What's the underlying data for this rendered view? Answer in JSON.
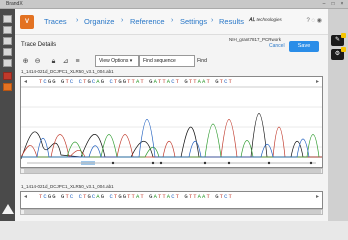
{
  "window": {
    "title": "BrandX"
  },
  "app": {
    "logo_label": "V"
  },
  "nav": {
    "tabs": [
      {
        "label": "Traces"
      },
      {
        "label": "Organize"
      },
      {
        "label": "Reference"
      },
      {
        "label": "Settings"
      },
      {
        "label": "Results"
      }
    ],
    "separator": "›"
  },
  "brand": {
    "label": "technologies"
  },
  "header": {
    "section_title": "Trace Details",
    "file_name": "NIH_grant7817_PCRwork",
    "cancel_label": "Cancel",
    "save_label": "Save"
  },
  "toolbar": {
    "view_options_label": "View Options ▾",
    "find_value": "Find sequence",
    "find_label": "Find"
  },
  "traces": [
    {
      "label": "1_1414-021d_DCJPC1_XLR50_v3.1_004.ab1",
      "sequence": [
        {
          "b": "T",
          "c": "#c0392b"
        },
        {
          "b": "C",
          "c": "#1f5fbf"
        },
        {
          "b": "G",
          "c": "#111"
        },
        {
          "b": "G",
          "c": "#111"
        },
        {
          "b": " ",
          "c": "#111"
        },
        {
          "b": "G",
          "c": "#111"
        },
        {
          "b": "T",
          "c": "#c0392b"
        },
        {
          "b": "C",
          "c": "#1f5fbf"
        },
        {
          "b": " ",
          "c": "#111"
        },
        {
          "b": "C",
          "c": "#1f5fbf"
        },
        {
          "b": "T",
          "c": "#c0392b"
        },
        {
          "b": "G",
          "c": "#111"
        },
        {
          "b": "C",
          "c": "#1f5fbf"
        },
        {
          "b": "A",
          "c": "#2e9b2e"
        },
        {
          "b": "G",
          "c": "#111"
        },
        {
          "b": " ",
          "c": "#111"
        },
        {
          "b": "C",
          "c": "#1f5fbf"
        },
        {
          "b": "T",
          "c": "#c0392b"
        },
        {
          "b": "G",
          "c": "#111"
        },
        {
          "b": "G",
          "c": "#111"
        },
        {
          "b": "T",
          "c": "#c0392b"
        },
        {
          "b": "T",
          "c": "#c0392b"
        },
        {
          "b": "A",
          "c": "#2e9b2e"
        },
        {
          "b": "T",
          "c": "#c0392b"
        },
        {
          "b": " ",
          "c": "#111"
        },
        {
          "b": "G",
          "c": "#111"
        },
        {
          "b": "A",
          "c": "#2e9b2e"
        },
        {
          "b": "T",
          "c": "#c0392b"
        },
        {
          "b": "T",
          "c": "#c0392b"
        },
        {
          "b": "A",
          "c": "#2e9b2e"
        },
        {
          "b": "C",
          "c": "#1f5fbf"
        },
        {
          "b": "T",
          "c": "#c0392b"
        },
        {
          "b": " ",
          "c": "#111"
        },
        {
          "b": "G",
          "c": "#111"
        },
        {
          "b": "T",
          "c": "#c0392b"
        },
        {
          "b": "T",
          "c": "#c0392b"
        },
        {
          "b": "A",
          "c": "#2e9b2e"
        },
        {
          "b": "A",
          "c": "#2e9b2e"
        },
        {
          "b": "T",
          "c": "#c0392b"
        },
        {
          "b": " ",
          "c": "#111"
        },
        {
          "b": "G",
          "c": "#111"
        },
        {
          "b": "T",
          "c": "#c0392b"
        },
        {
          "b": "C",
          "c": "#1f5fbf"
        },
        {
          "b": "T",
          "c": "#c0392b"
        }
      ]
    },
    {
      "label": "1_1414-021d_DCJPC1_XLR50_v3.1_004.ab1",
      "sequence": [
        {
          "b": "T",
          "c": "#c0392b"
        },
        {
          "b": "C",
          "c": "#1f5fbf"
        },
        {
          "b": "G",
          "c": "#111"
        },
        {
          "b": "G",
          "c": "#111"
        },
        {
          "b": " ",
          "c": "#111"
        },
        {
          "b": "G",
          "c": "#111"
        },
        {
          "b": "T",
          "c": "#c0392b"
        },
        {
          "b": "C",
          "c": "#1f5fbf"
        },
        {
          "b": " ",
          "c": "#111"
        },
        {
          "b": "C",
          "c": "#1f5fbf"
        },
        {
          "b": "T",
          "c": "#c0392b"
        },
        {
          "b": "G",
          "c": "#111"
        },
        {
          "b": "C",
          "c": "#1f5fbf"
        },
        {
          "b": "A",
          "c": "#2e9b2e"
        },
        {
          "b": "G",
          "c": "#111"
        },
        {
          "b": " ",
          "c": "#111"
        },
        {
          "b": "C",
          "c": "#1f5fbf"
        },
        {
          "b": "T",
          "c": "#c0392b"
        },
        {
          "b": "G",
          "c": "#111"
        },
        {
          "b": "G",
          "c": "#111"
        },
        {
          "b": "T",
          "c": "#c0392b"
        },
        {
          "b": "T",
          "c": "#c0392b"
        },
        {
          "b": "A",
          "c": "#2e9b2e"
        },
        {
          "b": "T",
          "c": "#c0392b"
        },
        {
          "b": " ",
          "c": "#111"
        },
        {
          "b": "G",
          "c": "#111"
        },
        {
          "b": "A",
          "c": "#2e9b2e"
        },
        {
          "b": "T",
          "c": "#c0392b"
        },
        {
          "b": "T",
          "c": "#c0392b"
        },
        {
          "b": "A",
          "c": "#2e9b2e"
        },
        {
          "b": "C",
          "c": "#1f5fbf"
        },
        {
          "b": "T",
          "c": "#c0392b"
        },
        {
          "b": " ",
          "c": "#111"
        },
        {
          "b": "G",
          "c": "#111"
        },
        {
          "b": "T",
          "c": "#c0392b"
        },
        {
          "b": "T",
          "c": "#c0392b"
        },
        {
          "b": "A",
          "c": "#2e9b2e"
        },
        {
          "b": "A",
          "c": "#2e9b2e"
        },
        {
          "b": "T",
          "c": "#c0392b"
        },
        {
          "b": " ",
          "c": "#111"
        },
        {
          "b": "G",
          "c": "#111"
        },
        {
          "b": "T",
          "c": "#c0392b"
        },
        {
          "b": "C",
          "c": "#1f5fbf"
        },
        {
          "b": "T",
          "c": "#c0392b"
        }
      ]
    }
  ],
  "colors": {
    "accent": "#2a78c8",
    "save": "#2a8de8",
    "logo": "#e37222",
    "base_A": "#2e9b2e",
    "base_C": "#1f5fbf",
    "base_G": "#111111",
    "base_T": "#c0392b"
  },
  "icons": {
    "zoom_in": "zoom-in-icon",
    "zoom_out": "zoom-out-icon",
    "lock": "lock-icon",
    "pin": "pin-icon",
    "nav_left": "arrow-left-icon",
    "nav_right": "arrow-right-icon"
  }
}
